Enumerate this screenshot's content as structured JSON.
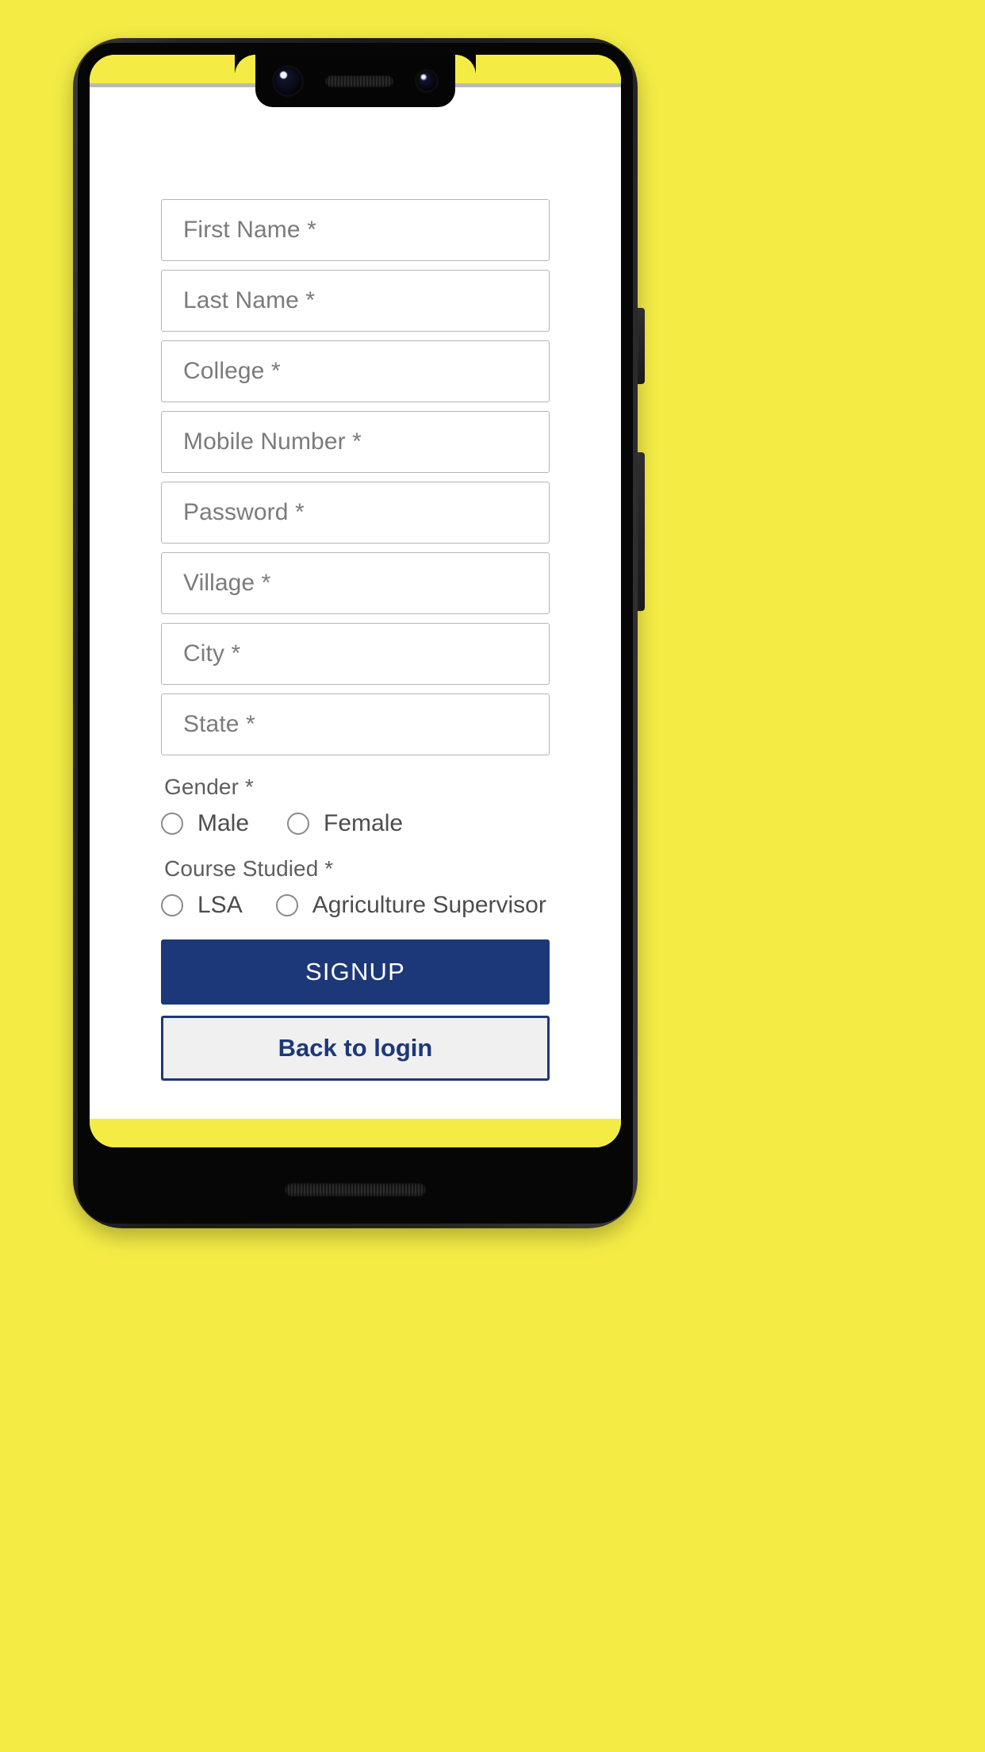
{
  "theme": {
    "background_color": "#F4EC45",
    "primary_color": "#1d3878",
    "field_border_color": "#b5b5b5",
    "placeholder_color": "#7b7b7b",
    "secondary_button_bg": "#f0f0f0"
  },
  "form": {
    "fields": [
      {
        "name": "first-name",
        "placeholder": "First Name *",
        "value": ""
      },
      {
        "name": "last-name",
        "placeholder": "Last Name *",
        "value": ""
      },
      {
        "name": "college",
        "placeholder": "College *",
        "value": ""
      },
      {
        "name": "mobile-number",
        "placeholder": "Mobile Number *",
        "value": ""
      },
      {
        "name": "password",
        "placeholder": "Password *",
        "value": ""
      },
      {
        "name": "village",
        "placeholder": "Village *",
        "value": ""
      },
      {
        "name": "city",
        "placeholder": "City *",
        "value": ""
      },
      {
        "name": "state",
        "placeholder": "State *",
        "value": ""
      }
    ],
    "gender": {
      "label": "Gender *",
      "options": [
        {
          "label": "Male",
          "selected": false
        },
        {
          "label": "Female",
          "selected": false
        }
      ]
    },
    "course": {
      "label": "Course Studied *",
      "options": [
        {
          "label": "LSA",
          "selected": false
        },
        {
          "label": "Agriculture Supervisor",
          "selected": false
        }
      ]
    },
    "buttons": {
      "signup_label": "SIGNUP",
      "back_to_login_label": "Back to login"
    }
  },
  "device": {
    "icons": {
      "front_camera_main": "camera-icon",
      "front_camera_secondary": "camera-icon",
      "earpiece": "speaker-grille-icon",
      "bottom_speaker": "speaker-grille-icon",
      "power_button": "power-button",
      "volume_button": "volume-button"
    }
  }
}
